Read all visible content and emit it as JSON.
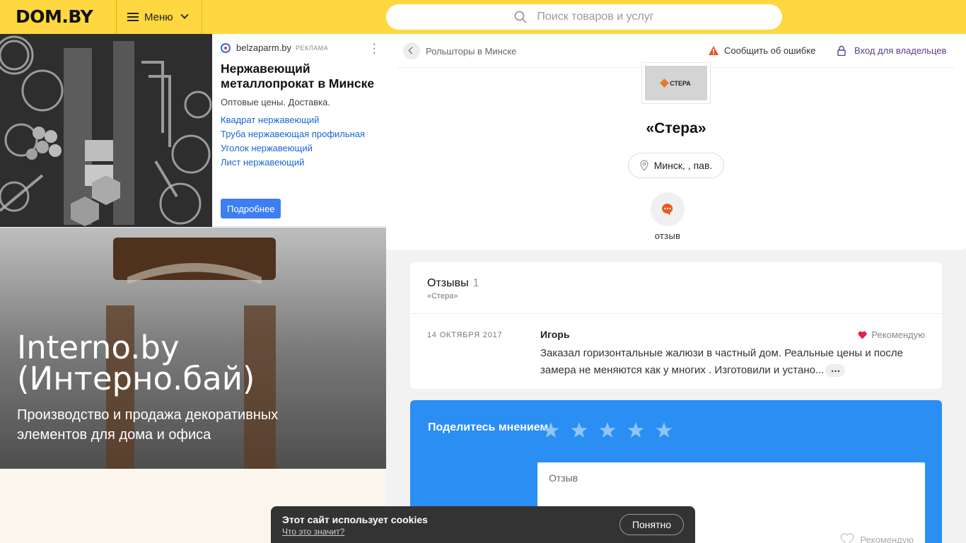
{
  "header": {
    "logo": "DOM.BY",
    "menu_label": "Меню",
    "search_placeholder": "Поиск товаров и услуг"
  },
  "ad": {
    "source": "belzaparm.by",
    "tag": "РЕКЛАМА",
    "title": "Нержавеющий металлопрокат в Минске",
    "description": "Оптовые цены. Доставка.",
    "links": [
      "Квадрат нержавеющий",
      "Труба нержавеющая профильная",
      "Уголок нержавеющий",
      "Лист нержавеющий"
    ],
    "button": "Подробнее"
  },
  "promo": {
    "title": "Interno.by (Интерно.бай)",
    "subtitle": "Производство и продажа декоративных элементов для дома и офиса"
  },
  "company": {
    "breadcrumb": "Рольшторы в Минске",
    "report_error": "Сообщить об ошибке",
    "owners_login": "Вход для владельцев",
    "logo_text": "СТЕРА",
    "name": "«Стера»",
    "address": "Минск, , пав.",
    "review_action": "отзыв"
  },
  "reviews": {
    "title": "Отзывы",
    "count": "1",
    "subtitle": "«Стера»",
    "items": [
      {
        "date": "14 ОКТЯБРЯ 2017",
        "author": "Игорь",
        "recommend": "Рекомендую",
        "text": "Заказал горизонтальные жалюзи в частный дом. Реальные цены и после замера не меняются как у многих . Изготовили и устано..."
      }
    ]
  },
  "share": {
    "title": "Поделитесь мнением",
    "stars": 5,
    "input_placeholder": "Отзыв",
    "recommend": "Рекомендую"
  },
  "cookie": {
    "title": "Этот сайт использует cookies",
    "link": "Что это значит?",
    "button": "Понятно"
  },
  "colors": {
    "header_bg": "#ffd740",
    "share_bg": "#2a8ef2",
    "link": "#1a64d6",
    "owners_link": "#5b3f8e",
    "warning": "#e8542a",
    "heart": "#e0234e"
  }
}
